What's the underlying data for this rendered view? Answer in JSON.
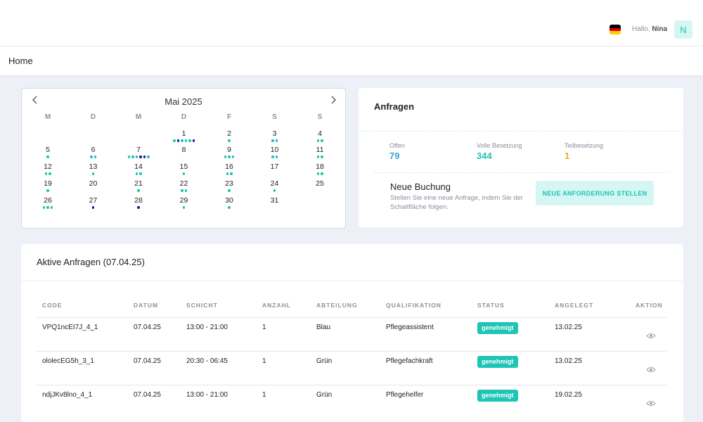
{
  "header": {
    "greeting": "Hallo,",
    "user_name": "Nina",
    "avatar_initial": "N",
    "flag_icon": "germany-flag-icon",
    "flag_colors": [
      "#000000",
      "#dd0000",
      "#ffce00"
    ]
  },
  "page": {
    "title": "Home"
  },
  "calendar": {
    "month_label": "Mai 2025",
    "weekdays": [
      "M",
      "D",
      "M",
      "D",
      "F",
      "S",
      "S"
    ],
    "prev_icon": "chevron-left-icon",
    "next_icon": "chevron-right-icon",
    "dot_colors": {
      "t": "#1ec4b4",
      "n": "#1a1aa0"
    },
    "days": [
      {
        "d": "1",
        "dots": "tntttn"
      },
      {
        "d": "2",
        "dots": "t"
      },
      {
        "d": "3",
        "dots": "tt"
      },
      {
        "d": "4",
        "dots": "tt"
      },
      {
        "d": "5",
        "dots": "t"
      },
      {
        "d": "6",
        "dots": "tt"
      },
      {
        "d": "7",
        "dots": "tttnnt"
      },
      {
        "d": "8",
        "dots": ""
      },
      {
        "d": "9",
        "dots": "ttt"
      },
      {
        "d": "10",
        "dots": "tt"
      },
      {
        "d": "11",
        "dots": "tt"
      },
      {
        "d": "12",
        "dots": "tt"
      },
      {
        "d": "13",
        "dots": "t"
      },
      {
        "d": "14",
        "dots": "tt"
      },
      {
        "d": "15",
        "dots": "t"
      },
      {
        "d": "16",
        "dots": "tt"
      },
      {
        "d": "17",
        "dots": ""
      },
      {
        "d": "18",
        "dots": "tt"
      },
      {
        "d": "19",
        "dots": "t"
      },
      {
        "d": "20",
        "dots": ""
      },
      {
        "d": "21",
        "dots": "t"
      },
      {
        "d": "22",
        "dots": "tt"
      },
      {
        "d": "23",
        "dots": "t"
      },
      {
        "d": "24",
        "dots": "t"
      },
      {
        "d": "25",
        "dots": ""
      },
      {
        "d": "26",
        "dots": "ttt"
      },
      {
        "d": "27",
        "dots": "n"
      },
      {
        "d": "28",
        "dots": "n"
      },
      {
        "d": "29",
        "dots": "t"
      },
      {
        "d": "30",
        "dots": "t"
      },
      {
        "d": "31",
        "dots": ""
      }
    ]
  },
  "requests": {
    "title": "Anfragen",
    "stats": [
      {
        "label": "Offen",
        "value": "79",
        "color": "#3aa0d8"
      },
      {
        "label": "Volle Besetzung",
        "value": "344",
        "color": "#1ec4b4"
      },
      {
        "label": "Teilbesetzung",
        "value": "1",
        "color": "#f5a623"
      }
    ],
    "new_booking": {
      "title": "Neue Buchung",
      "description": "Stellen Sie eine neue Anfrage, indem Sie der Schaltfläche folgen.",
      "button_label": "NEUE ANFORDERUNG STELLEN"
    }
  },
  "active": {
    "title": "Aktive Anfragen (07.04.25)",
    "columns": [
      "CODE",
      "DATUM",
      "SCHICHT",
      "ANZAHL",
      "ABTEILUNG",
      "QUALIFIKATION",
      "STATUS",
      "ANGELEGT",
      "AKTION"
    ],
    "rows": [
      {
        "code": "VPQ1ncEI7J_4_1",
        "datum": "07.04.25",
        "schicht": "13:00 - 21:00",
        "anzahl": "1",
        "abteilung": "Blau",
        "qualifikation": "Pflegeassistent",
        "status": "genehmigt",
        "angelegt": "13.02.25"
      },
      {
        "code": "ololecEG5h_3_1",
        "datum": "07.04.25",
        "schicht": "20:30 - 06:45",
        "anzahl": "1",
        "abteilung": "Grün",
        "qualifikation": "Pflegefachkraft",
        "status": "genehmigt",
        "angelegt": "13.02.25"
      },
      {
        "code": "ndjJKv8lno_4_1",
        "datum": "07.04.25",
        "schicht": "13:00 - 21:00",
        "anzahl": "1",
        "abteilung": "Grün",
        "qualifikation": "Pflegehelfer",
        "status": "genehmigt",
        "angelegt": "19.02.25"
      }
    ],
    "action_icon": "eye-icon",
    "status_color": "#1ec4b4"
  }
}
